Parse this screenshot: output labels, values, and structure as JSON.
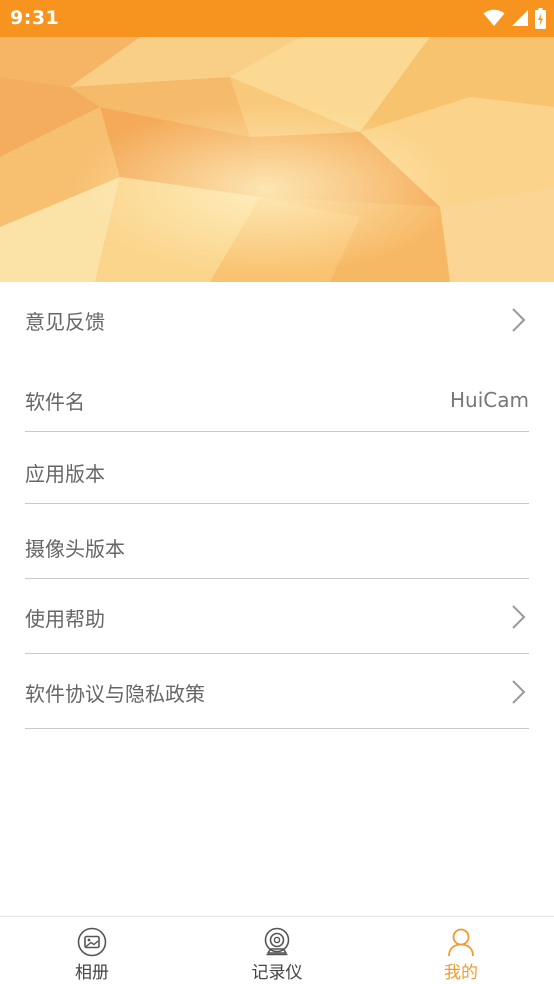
{
  "status_bar": {
    "time": "9:31",
    "icons": [
      "wifi-icon",
      "signal-icon",
      "battery-charging-icon"
    ],
    "color": "#f7941f"
  },
  "settings_list": {
    "items": [
      {
        "label": "意见反馈",
        "value": "",
        "has_chevron": true
      },
      {
        "label": "软件名",
        "value": "HuiCam",
        "has_chevron": false
      },
      {
        "label": "应用版本",
        "value": "",
        "has_chevron": false
      },
      {
        "label": "摄像头版本",
        "value": "",
        "has_chevron": false
      },
      {
        "label": "使用帮助",
        "value": "",
        "has_chevron": true
      },
      {
        "label": "软件协议与隐私政策",
        "value": "",
        "has_chevron": true
      }
    ]
  },
  "bottom_nav": {
    "items": [
      {
        "label": "相册",
        "icon": "album-icon",
        "active": false
      },
      {
        "label": "记录仪",
        "icon": "camera-recorder-icon",
        "active": false
      },
      {
        "label": "我的",
        "icon": "user-profile-icon",
        "active": true
      }
    ],
    "active_color": "#f39a2d",
    "inactive_color": "#444444"
  }
}
